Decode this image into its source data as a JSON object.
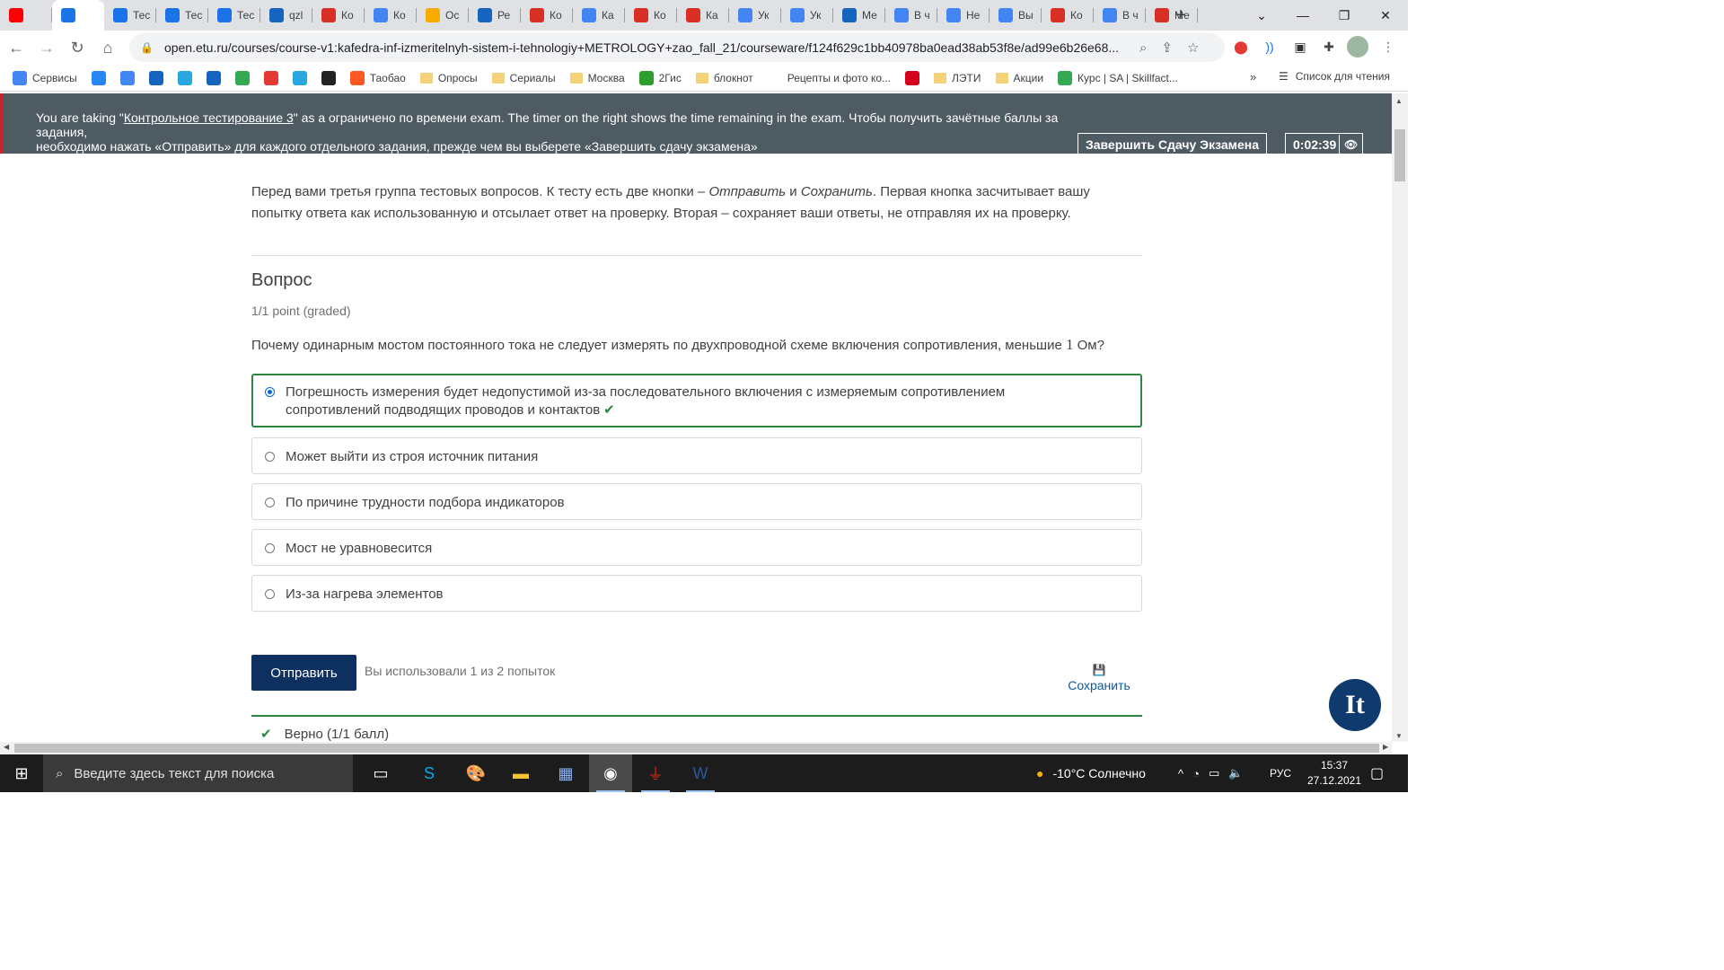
{
  "browser": {
    "tabs": [
      {
        "label": "",
        "icon": "youtube-icon",
        "color": "#ff0000"
      },
      {
        "label": "",
        "icon": "edge-icon",
        "color": "#1a73e8",
        "active": true
      },
      {
        "label": "Тес",
        "icon": "page-icon",
        "color": "#1a73e8"
      },
      {
        "label": "Тес",
        "icon": "page-icon",
        "color": "#1a73e8"
      },
      {
        "label": "Тес",
        "icon": "page-icon",
        "color": "#1a73e8"
      },
      {
        "label": "qzl",
        "icon": "skillfactory-icon",
        "color": "#1565c0"
      },
      {
        "label": "Ко",
        "icon": "grid-icon",
        "color": "#d93025"
      },
      {
        "label": "Ко",
        "icon": "google-icon",
        "color": "#4285f4"
      },
      {
        "label": "Ос",
        "icon": "cloud-icon",
        "color": "#f9ab00"
      },
      {
        "label": "Ре",
        "icon": "skillfactory-icon",
        "color": "#1565c0"
      },
      {
        "label": "Ко",
        "icon": "grid-icon",
        "color": "#d93025"
      },
      {
        "label": "Ка",
        "icon": "google-icon",
        "color": "#4285f4"
      },
      {
        "label": "Ко",
        "icon": "grid-icon",
        "color": "#d93025"
      },
      {
        "label": "Ка",
        "icon": "windows-icon",
        "color": "#d93025"
      },
      {
        "label": "Ук",
        "icon": "google-icon",
        "color": "#4285f4"
      },
      {
        "label": "Ук",
        "icon": "google-icon",
        "color": "#4285f4"
      },
      {
        "label": "Ме",
        "icon": "skillfactory-icon",
        "color": "#1565c0"
      },
      {
        "label": "В ч",
        "icon": "google-icon",
        "color": "#4285f4"
      },
      {
        "label": "Не",
        "icon": "google-icon",
        "color": "#4285f4"
      },
      {
        "label": "Вы",
        "icon": "google-icon",
        "color": "#4285f4"
      },
      {
        "label": "Ко",
        "icon": "grid-icon",
        "color": "#d93025"
      },
      {
        "label": "В ч",
        "icon": "google-icon",
        "color": "#4285f4"
      },
      {
        "label": "Ме",
        "icon": "grid-icon",
        "color": "#d93025"
      }
    ],
    "url": "open.etu.ru/courses/course-v1:kafedra-inf-izmeritelnyh-sistem-i-tehnologiy+METROLOGY+zao_fall_21/courseware/f124f629c1bb40978ba0ead38ab53f8e/ad99e6b26e68...",
    "bookmarks": [
      {
        "label": "Сервисы",
        "icon": "apps-icon",
        "color": "#4285f4"
      },
      {
        "label": "",
        "icon": "vk-icon",
        "color": "#2787f5"
      },
      {
        "label": "",
        "icon": "translate-icon",
        "color": "#4285f4"
      },
      {
        "label": "",
        "icon": "mail-icon",
        "color": "#1565c0"
      },
      {
        "label": "",
        "icon": "cloud-icon",
        "color": "#29a8e0"
      },
      {
        "label": "",
        "icon": "at-icon",
        "color": "#1565c0"
      },
      {
        "label": "",
        "icon": "check-icon",
        "color": "#34a853"
      },
      {
        "label": "",
        "icon": "mail-icon",
        "color": "#e53935"
      },
      {
        "label": "",
        "icon": "drop-icon",
        "color": "#29a8e0"
      },
      {
        "label": "",
        "icon": "d-icon",
        "color": "#222222"
      },
      {
        "label": "Таобао",
        "icon": "taobao-icon",
        "color": "#ff5722"
      },
      {
        "label": "Опросы",
        "icon": "folder-icon",
        "color": ""
      },
      {
        "label": "Сериалы",
        "icon": "folder-icon",
        "color": ""
      },
      {
        "label": "Москва",
        "icon": "folder-icon",
        "color": ""
      },
      {
        "label": "2Гис",
        "icon": "2gis-icon",
        "color": "#2e9e2e"
      },
      {
        "label": "блокнот",
        "icon": "folder-icon",
        "color": ""
      },
      {
        "label": "Рецепты и фото ко...",
        "icon": "recipe-icon",
        "color": "#ffffff"
      },
      {
        "label": "",
        "icon": "hh-icon",
        "color": "#d6001c"
      },
      {
        "label": "ЛЭТИ",
        "icon": "folder-icon",
        "color": ""
      },
      {
        "label": "Акции",
        "icon": "folder-icon",
        "color": ""
      },
      {
        "label": "Курс | SA | Skillfact...",
        "icon": "sf-icon",
        "color": "#34a853"
      }
    ],
    "more_bookmarks": "»",
    "reading_list": "Список для чтения"
  },
  "exam_banner": {
    "prefix": "You are taking \"",
    "link": "Контрольное тестирование 3",
    "line1_rest": "\" as a ограничено по времени exam. The timer on the right shows the time remaining in the exam. Чтобы получить зачётные баллы за задания,",
    "line2": "необходимо нажать «Отправить» для каждого отдельного задания, прежде чем вы выберете «Завершить сдачу экзамена»",
    "finish_button": "Завершить Сдачу Экзамена",
    "timer": "0:02:39",
    "accent_color": "#c1272d"
  },
  "problem": {
    "intro_part1": "Перед вами третья группа тестовых вопросов. К тесту есть две кнопки – ",
    "intro_em1": "Отправить",
    "intro_and": " и ",
    "intro_em2": "Сохранить",
    "intro_part2": ". Первая кнопка засчитывает вашу",
    "intro_line2": "попытку ответа как использованную и отсылает ответ на проверку. Вторая – сохраняет ваши ответы, не отправляя их на проверку.",
    "title": "Вопрос",
    "points": "1/1 point (graded)",
    "question_before": "Почему одинарным мостом постоянного тока не следует измерять по двухпроводной схеме включения сопротивления, меньшие ",
    "question_num": "1",
    "question_after": " Ом?",
    "options": [
      {
        "line1": "Погрешность измерения будет недопустимой из-за последовательного включения с измеряемым сопротивлением",
        "line2": "сопротивлений подводящих проводов и контактов",
        "selected": true,
        "correct": true
      },
      {
        "line1": "Может выйти из строя источник питания",
        "line2": "",
        "selected": false,
        "correct": false
      },
      {
        "line1": "По причине трудности подбора индикаторов",
        "line2": "",
        "selected": false,
        "correct": false
      },
      {
        "line1": "Мост не уравновесится",
        "line2": "",
        "selected": false,
        "correct": false
      },
      {
        "line1": "Из-за нагрева элементов",
        "line2": "",
        "selected": false,
        "correct": false
      }
    ],
    "submit_label": "Отправить",
    "attempts": "Вы использовали 1 из 2 попыток",
    "save_label": "Сохранить",
    "result": "Верно (1/1 балл)",
    "logo_text": "It",
    "success_color": "#2e8540",
    "button_color": "#0e3060"
  },
  "taskbar": {
    "search_placeholder": "Введите здесь текст для поиска",
    "weather": "-10°C  Солнечно",
    "language": "РУС",
    "time": "15:37",
    "date": "27.12.2021"
  }
}
